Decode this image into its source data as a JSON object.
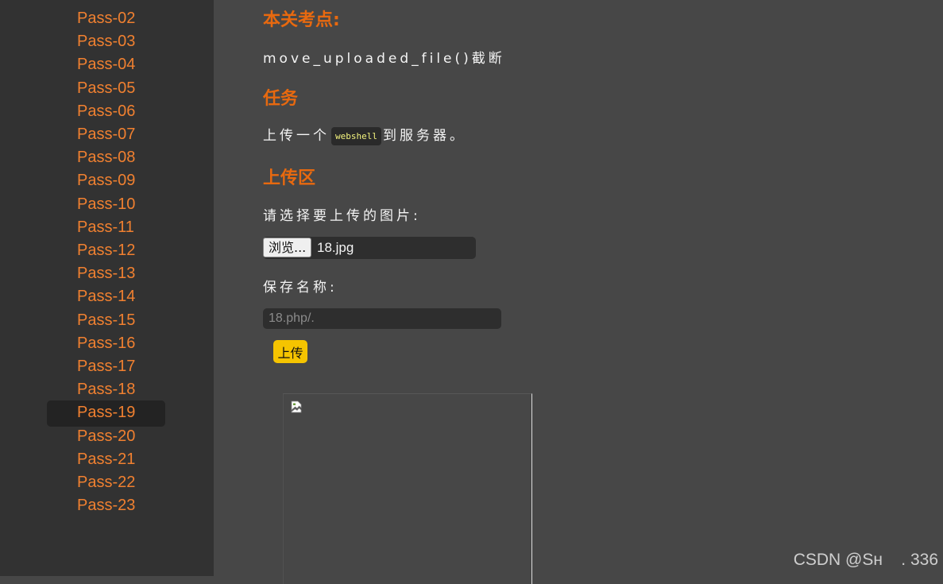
{
  "sidebar": {
    "items": [
      {
        "label": "Pass-02",
        "active": false
      },
      {
        "label": "Pass-03",
        "active": false
      },
      {
        "label": "Pass-04",
        "active": false
      },
      {
        "label": "Pass-05",
        "active": false
      },
      {
        "label": "Pass-06",
        "active": false
      },
      {
        "label": "Pass-07",
        "active": false
      },
      {
        "label": "Pass-08",
        "active": false
      },
      {
        "label": "Pass-09",
        "active": false
      },
      {
        "label": "Pass-10",
        "active": false
      },
      {
        "label": "Pass-11",
        "active": false
      },
      {
        "label": "Pass-12",
        "active": false
      },
      {
        "label": "Pass-13",
        "active": false
      },
      {
        "label": "Pass-14",
        "active": false
      },
      {
        "label": "Pass-15",
        "active": false
      },
      {
        "label": "Pass-16",
        "active": false
      },
      {
        "label": "Pass-17",
        "active": false
      },
      {
        "label": "Pass-18",
        "active": false
      },
      {
        "label": "Pass-19",
        "active": true
      },
      {
        "label": "Pass-20",
        "active": false
      },
      {
        "label": "Pass-21",
        "active": false
      },
      {
        "label": "Pass-22",
        "active": false
      },
      {
        "label": "Pass-23",
        "active": false
      }
    ]
  },
  "main": {
    "checkpoint_heading": "本关考点:",
    "checkpoint_text": "move_uploaded_file()截断",
    "task_heading": "任务",
    "task_text_before": "上传一个",
    "task_code": "webshell",
    "task_text_after": "到服务器。",
    "upload_heading": "上传区",
    "choose_image_label": "请选择要上传的图片:",
    "browse_label": "浏览...",
    "selected_file": "18.jpg",
    "save_name_label": "保存名称:",
    "save_name_value": "18.php/.",
    "upload_button": "上传",
    "preview_icon": "broken-image-icon"
  },
  "watermark": "CSDN @Sн    . 336",
  "colors": {
    "accent_orange": "#e8690f",
    "nav_orange": "#f08030",
    "button_yellow": "#f5c400",
    "page_bg": "#474747",
    "sidebar_bg": "#323232"
  }
}
